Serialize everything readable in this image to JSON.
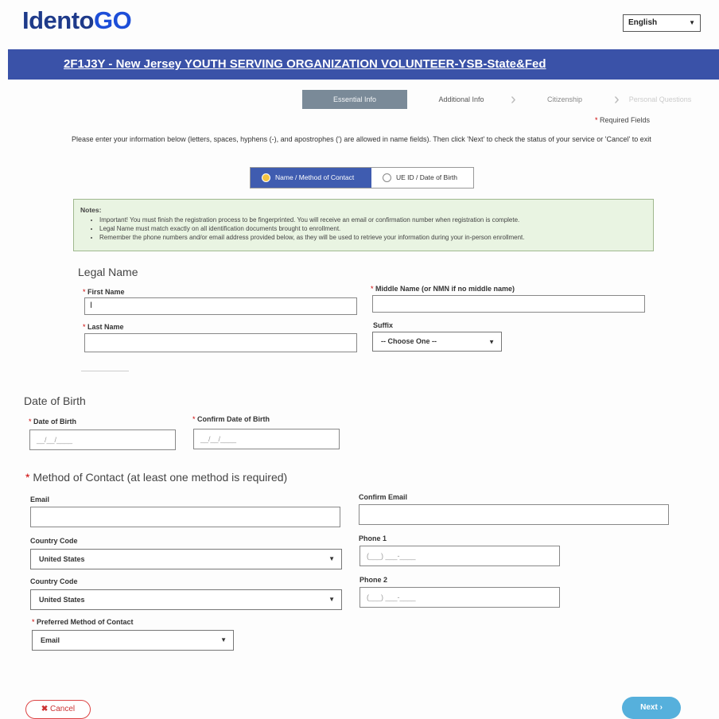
{
  "header": {
    "logo_main": "Idento",
    "logo_accent": "GO",
    "language": "English"
  },
  "banner": {
    "title": "2F1J3Y - New Jersey YOUTH SERVING ORGANIZATION VOLUNTEER-YSB-State&Fed"
  },
  "steps": [
    {
      "label": "Essential Info",
      "active": true
    },
    {
      "label": "Additional Info",
      "active": false
    },
    {
      "label": "Citizenship",
      "active": false
    },
    {
      "label": "Personal Questions",
      "active": false
    }
  ],
  "required_fields": "Required Fields",
  "intro": "Please enter your information below (letters, spaces, hyphens (-), and apostrophes (') are allowed in name fields). Then click 'Next' to check the status of your service or 'Cancel' to exit",
  "lookup_tabs": {
    "option1": "Name / Method of Contact",
    "option2": "UE ID / Date of Birth"
  },
  "notes": {
    "heading": "Notes:",
    "items": [
      "Important! You must finish the registration process to be fingerprinted. You will receive an email or confirmation number when registration is complete.",
      "Legal Name must match exactly on all identification documents brought to enrollment.",
      "Remember the phone numbers and/or email address provided below, as they will be used to retrieve your information during your in-person enrollment."
    ]
  },
  "legal_name": {
    "title": "Legal Name",
    "first_name_label": "First Name",
    "first_name_value": "I",
    "middle_name_label": "Middle Name (or NMN if no middle name)",
    "middle_name_value": "",
    "last_name_label": "Last Name",
    "last_name_value": "",
    "suffix_label": "Suffix",
    "suffix_value": "-- Choose One --"
  },
  "dob": {
    "title": "Date of Birth",
    "dob_label": "Date of Birth",
    "dob_placeholder": "__/__/____",
    "confirm_label": "Confirm Date of Birth",
    "confirm_placeholder": "__/__/____"
  },
  "contact": {
    "title": "Method of Contact (at least one method is required)",
    "email_label": "Email",
    "confirm_email_label": "Confirm Email",
    "country_code_label_1": "Country Code",
    "country_code_value_1": "United States",
    "phone1_label": "Phone 1",
    "phone1_placeholder": "(___) ___-____",
    "country_code_label_2": "Country Code",
    "country_code_value_2": "United States",
    "phone2_label": "Phone 2",
    "phone2_placeholder": "(___) ___-____",
    "preferred_label": "Preferred Method of Contact",
    "preferred_value": "Email"
  },
  "buttons": {
    "cancel": "Cancel",
    "next": "Next"
  },
  "colors": {
    "banner": "#3a52a8",
    "accent": "#3f5cb0",
    "next": "#56b0dc",
    "cancel": "#cc3333"
  }
}
